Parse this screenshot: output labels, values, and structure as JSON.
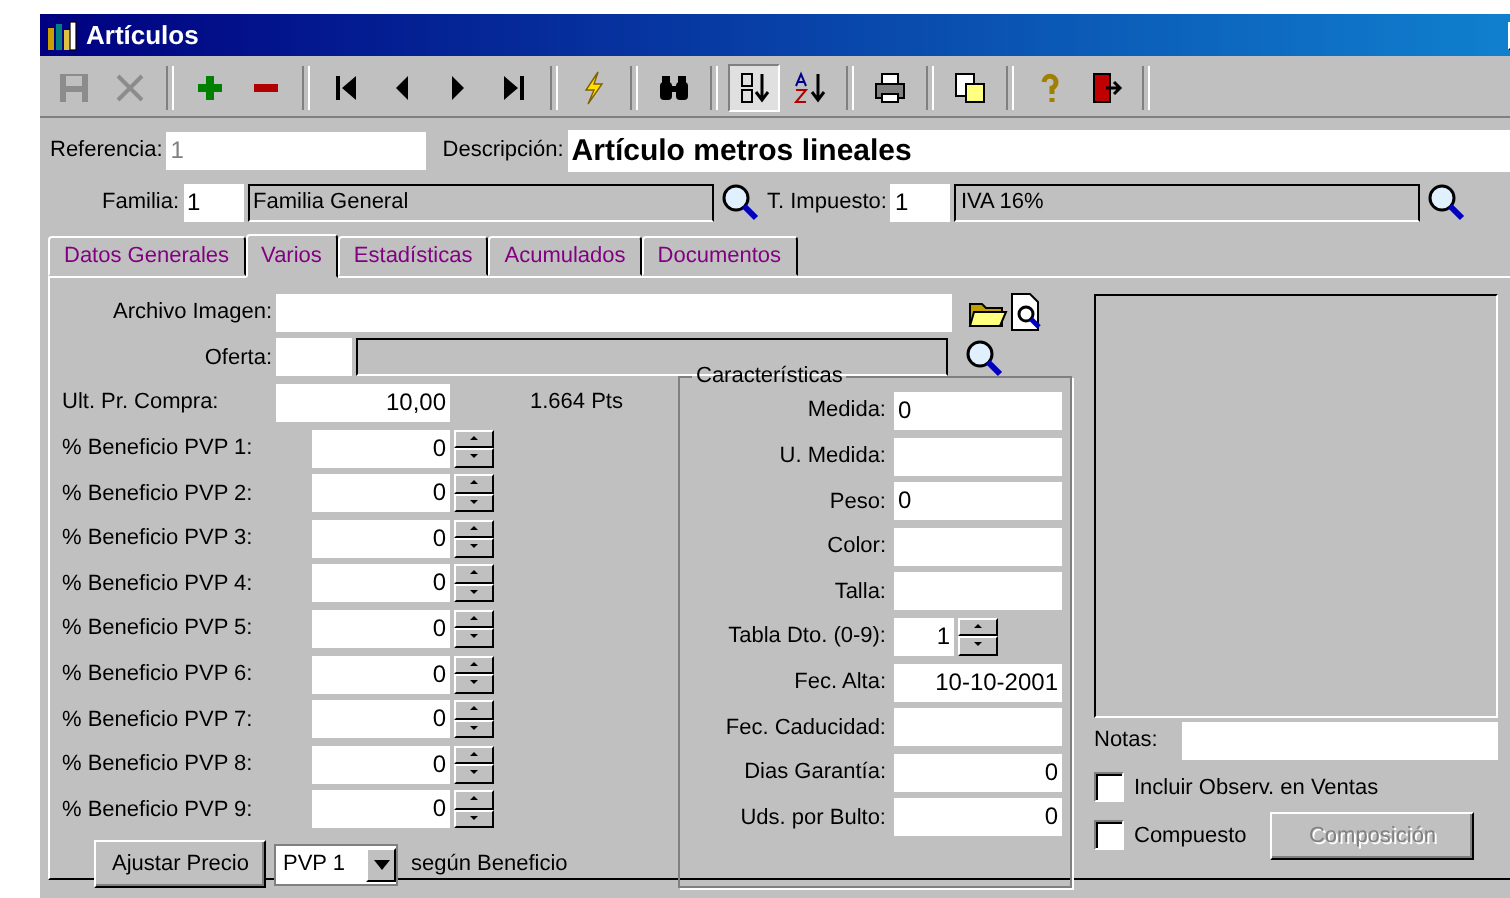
{
  "window": {
    "title": "Artículos"
  },
  "toolbar": [
    {
      "kind": "save",
      "disabled": true,
      "pressed": false
    },
    {
      "kind": "cancel",
      "disabled": true,
      "pressed": false
    },
    {
      "kind": "sep"
    },
    {
      "kind": "add",
      "disabled": false,
      "pressed": false
    },
    {
      "kind": "remove",
      "disabled": false,
      "pressed": false
    },
    {
      "kind": "sep"
    },
    {
      "kind": "first",
      "disabled": false,
      "pressed": false
    },
    {
      "kind": "prev",
      "disabled": false,
      "pressed": false
    },
    {
      "kind": "next",
      "disabled": false,
      "pressed": false
    },
    {
      "kind": "last",
      "disabled": false,
      "pressed": false
    },
    {
      "kind": "sep"
    },
    {
      "kind": "lightning",
      "disabled": false,
      "pressed": false
    },
    {
      "kind": "sep"
    },
    {
      "kind": "find",
      "disabled": false,
      "pressed": false
    },
    {
      "kind": "sep"
    },
    {
      "kind": "sortnum",
      "disabled": false,
      "pressed": true
    },
    {
      "kind": "sortalpha",
      "disabled": false,
      "pressed": false
    },
    {
      "kind": "sep"
    },
    {
      "kind": "print",
      "disabled": false,
      "pressed": false
    },
    {
      "kind": "sep"
    },
    {
      "kind": "copy",
      "disabled": false,
      "pressed": false
    },
    {
      "kind": "sep"
    },
    {
      "kind": "help",
      "disabled": false,
      "pressed": false
    },
    {
      "kind": "exit",
      "disabled": false,
      "pressed": false
    },
    {
      "kind": "sep"
    }
  ],
  "referencia": {
    "label": "Referencia:",
    "value": "1"
  },
  "descripcion": {
    "label": "Descripción:",
    "value": "Artículo metros lineales"
  },
  "familia": {
    "label": "Familia:",
    "code": "1",
    "name": "Familia General"
  },
  "impuesto": {
    "label": "T. Impuesto:",
    "code": "1",
    "name": "IVA 16%"
  },
  "tabs": [
    {
      "label": "Datos Generales",
      "selected": false
    },
    {
      "label": "Varios",
      "selected": true
    },
    {
      "label": "Estadísticas",
      "selected": false
    },
    {
      "label": "Acumulados",
      "selected": false
    },
    {
      "label": "Documentos",
      "selected": false
    }
  ],
  "archivo": {
    "label": "Archivo Imagen:"
  },
  "oferta": {
    "label": "Oferta:"
  },
  "ult_compra": {
    "label": "Ult. Pr. Compra:",
    "value": "10,00",
    "pesetas": "1.664",
    "currency": "Pts"
  },
  "beneficios": [
    {
      "label": "% Beneficio PVP 1:",
      "value": "0"
    },
    {
      "label": "% Beneficio PVP 2:",
      "value": "0"
    },
    {
      "label": "% Beneficio PVP 3:",
      "value": "0"
    },
    {
      "label": "% Beneficio PVP 4:",
      "value": "0"
    },
    {
      "label": "% Beneficio PVP 5:",
      "value": "0"
    },
    {
      "label": "% Beneficio PVP 6:",
      "value": "0"
    },
    {
      "label": "% Beneficio PVP 7:",
      "value": "0"
    },
    {
      "label": "% Beneficio PVP 8:",
      "value": "0"
    },
    {
      "label": "% Beneficio PVP 9:",
      "value": "0"
    }
  ],
  "ajustar": {
    "button": "Ajustar Precio",
    "select": "PVP 1",
    "suffix": "según Beneficio"
  },
  "caracteristicas": {
    "title": "Características",
    "fields": [
      {
        "label": "Medida:",
        "value": "0",
        "kind": "text"
      },
      {
        "label": "U. Medida:",
        "kind": "text"
      },
      {
        "label": "Peso:",
        "value": "0",
        "kind": "text"
      },
      {
        "label": "Color:",
        "kind": "text"
      },
      {
        "label": "Talla:",
        "kind": "text"
      },
      {
        "label": "Tabla Dto. (0-9):",
        "value": "1",
        "kind": "spin"
      },
      {
        "label": "Fec. Alta:",
        "value": "10-10-2001",
        "kind": "number"
      },
      {
        "label": "Fec. Caducidad:",
        "kind": "number"
      },
      {
        "label": "Dias Garantía:",
        "value": "0",
        "kind": "number"
      },
      {
        "label": "Uds. por Bulto:",
        "value": "0",
        "kind": "number"
      }
    ]
  },
  "notas": {
    "label": "Notas:"
  },
  "checks": [
    {
      "label": "Incluir Observ. en Ventas",
      "checked": false
    },
    {
      "label": "Compuesto",
      "checked": false
    }
  ],
  "composicion": {
    "label": "Composición",
    "disabled": true
  }
}
